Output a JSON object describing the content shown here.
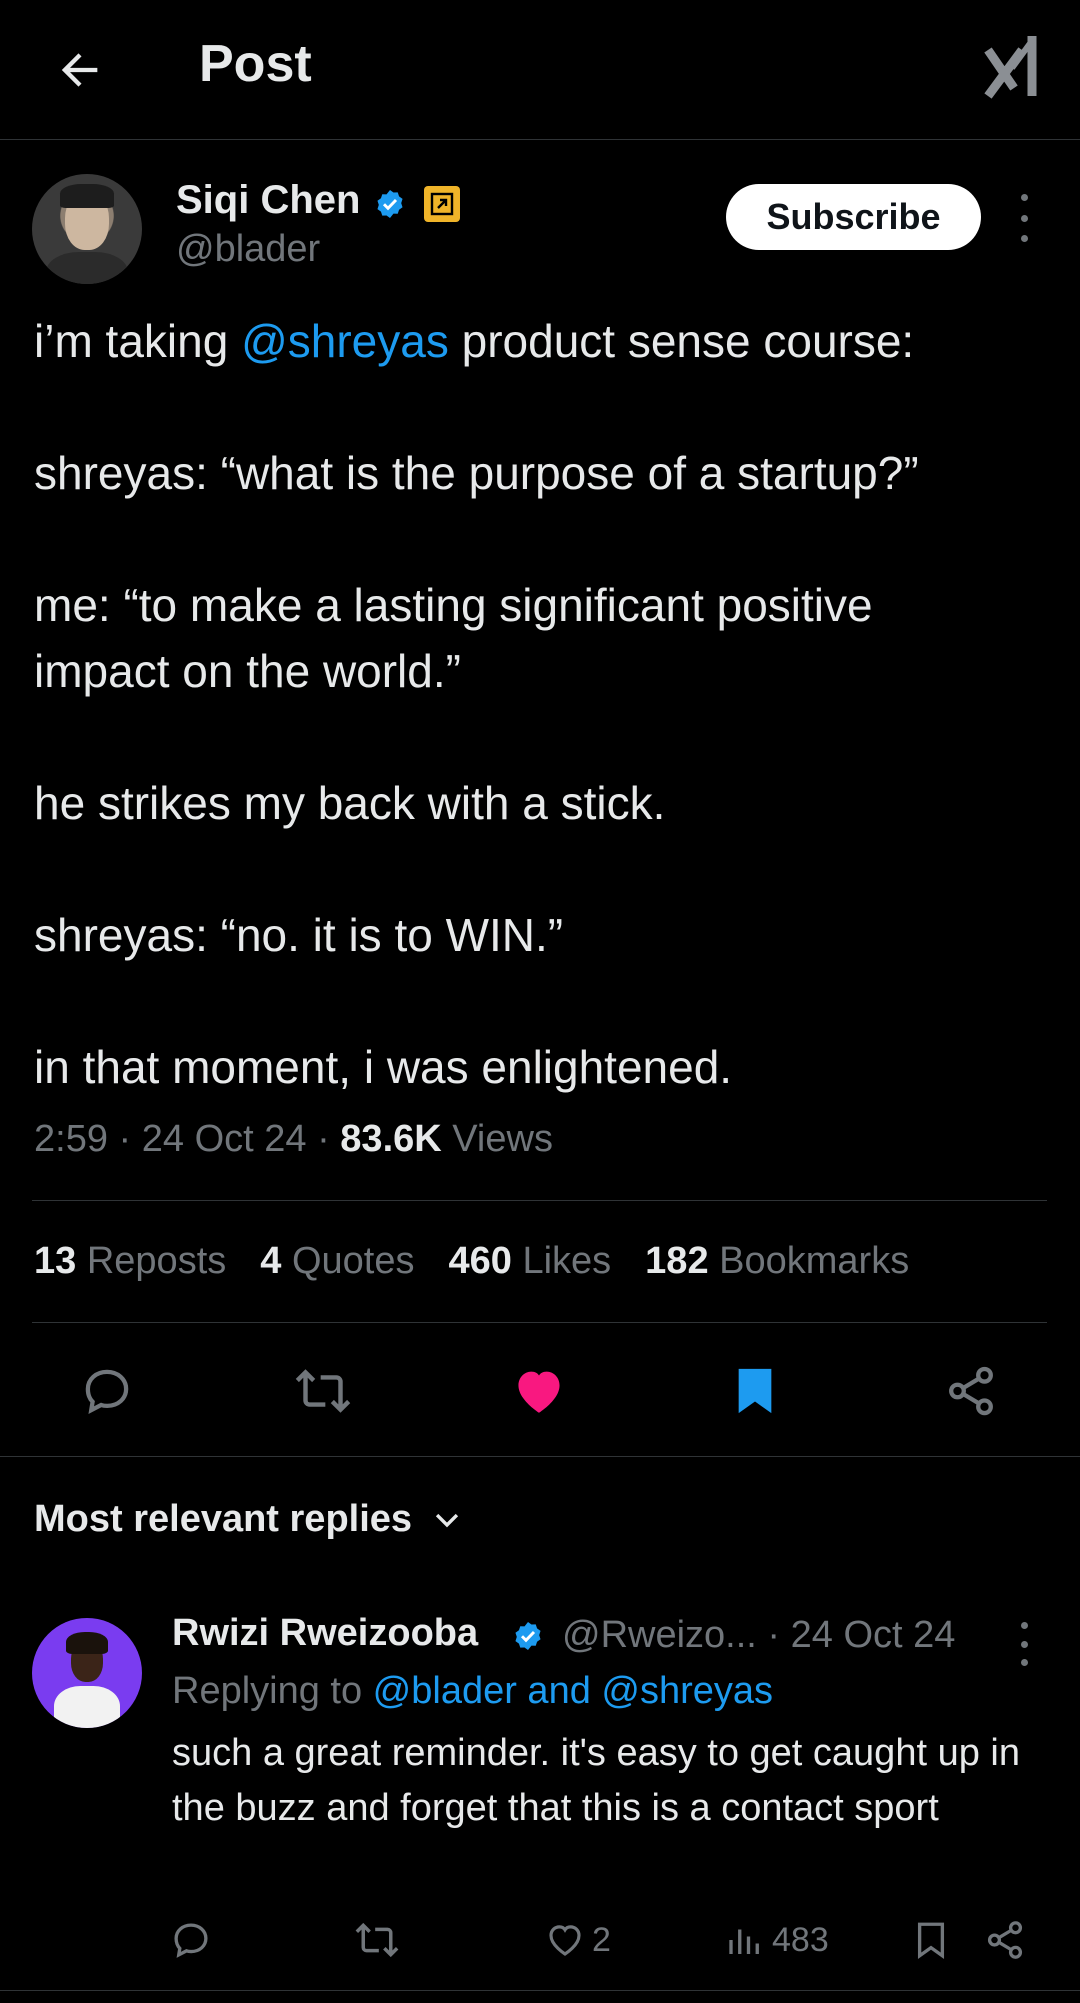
{
  "header": {
    "title": "Post",
    "back_icon": "arrow-left-icon",
    "grok_icon": "grok-icon"
  },
  "author": {
    "name": "Siqi Chen",
    "handle": "@blader",
    "subscribe_label": "Subscribe",
    "verified_color": "#1d9bf0",
    "affiliate_badge_color": "#f0b429"
  },
  "post": {
    "lines": [
      {
        "pre": "i’m taking ",
        "mention": "@shreyas",
        "post": " product sense course:"
      },
      {
        "text": "shreyas: “what is the purpose of a startup?”"
      },
      {
        "text": "me: “to make a lasting significant positive\nimpact on the world.”"
      },
      {
        "text": "he strikes my back with a stick."
      },
      {
        "text": "shreyas: “no. it is to WIN.”"
      },
      {
        "text": "in that moment, i was enlightened."
      }
    ],
    "time": "2:59",
    "date": "24 Oct 24",
    "views_count": "83.6K",
    "views_label": "Views"
  },
  "stats": {
    "reposts_count": "13",
    "reposts_label": "Reposts",
    "quotes_count": "4",
    "quotes_label": "Quotes",
    "likes_count": "460",
    "likes_label": "Likes",
    "bookmarks_count": "182",
    "bookmarks_label": "Bookmarks"
  },
  "actions": {
    "like_color": "#f91880",
    "bookmark_color": "#1d9bf0"
  },
  "replies": {
    "sort_label": "Most relevant replies",
    "items": [
      {
        "name": "Rwizi Rweizooba",
        "handle": "@Rweizo...",
        "date": "· 24 Oct 24",
        "replying_prefix": "Replying to ",
        "replying_to": "@blader and @shreyas",
        "text": "such a great reminder. it's easy to get caught up in the buzz and forget that this is a contact sport",
        "likes": "2",
        "views": "483"
      }
    ]
  }
}
